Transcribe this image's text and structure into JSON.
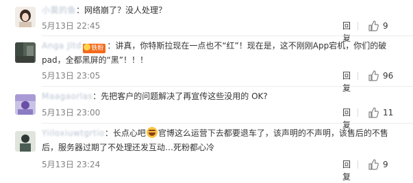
{
  "comments": [
    {
      "username": "小莫的鱼",
      "colon": "：",
      "text": "网络崩了？没人处理？",
      "time": "5月13日 22:45",
      "reply_label": "回复",
      "likes": "9"
    },
    {
      "username": "Anga Jltd",
      "badge": "铁粉",
      "colon": "：",
      "text": "讲真，你特斯拉现在一点也不“红”！现在是，这不刚刚App宕机，你们的破pad，全都黑屏的“黑”！！！",
      "time": "5月13日 23:05",
      "reply_label": "回复",
      "likes": "96"
    },
    {
      "username": "Maagaorlas",
      "colon": "：",
      "text": "先把客户的问题解决了再宣传这些没用的 OK?",
      "time": "5月13日 23:00",
      "reply_label": "回复",
      "likes": "11"
    },
    {
      "username": "Yiiloxiuwtgrtio",
      "colon": "：",
      "text_before_emoji": "长点心吧",
      "emoji": "laughing-emoji",
      "text_after_emoji": "官博这么运营下去都要退车了，该声明的不声明，该售后的不售后，服务器过期了不处理还发互动…死粉都心冷",
      "time": "5月13日 23:24",
      "reply_label": "回复",
      "likes": "9"
    }
  ],
  "colors": {
    "text": "#333333",
    "meta": "#808080",
    "badge": "#f36a1c",
    "divider": "#ececec"
  }
}
